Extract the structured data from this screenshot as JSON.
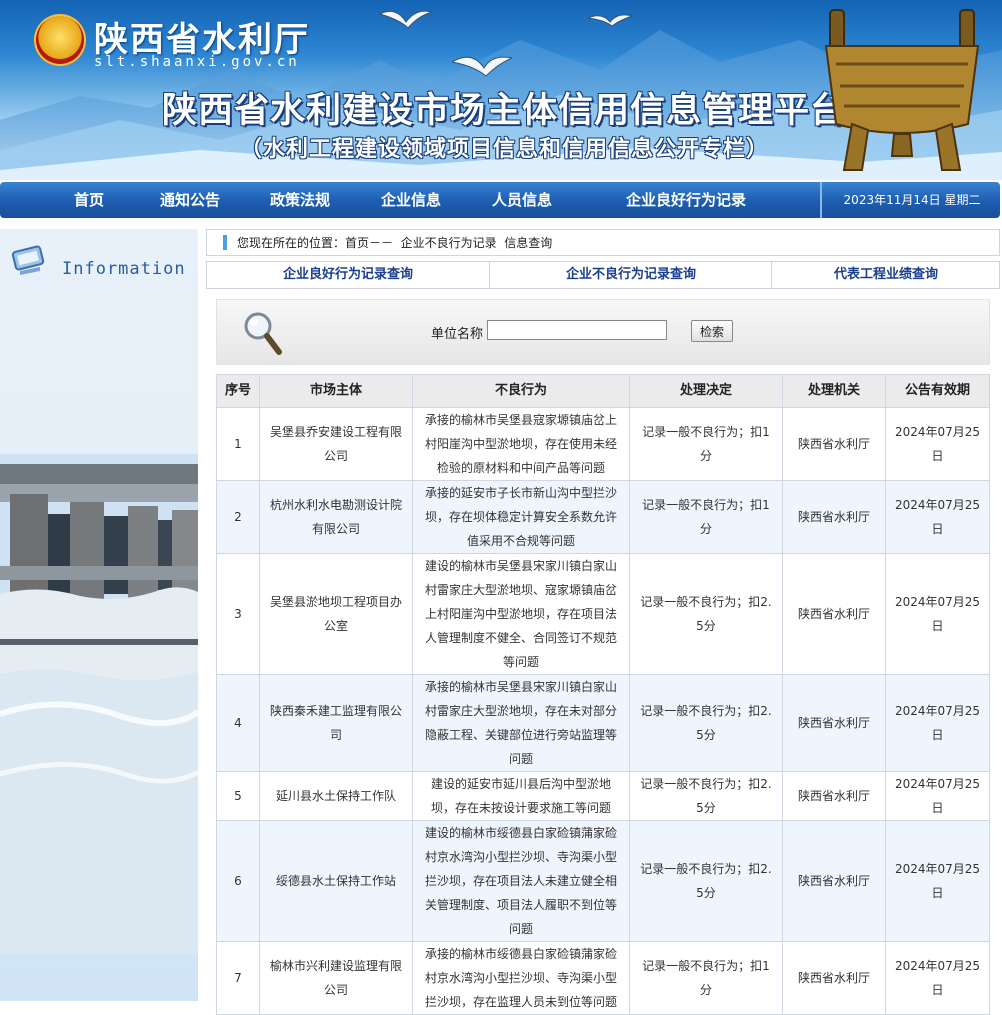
{
  "header": {
    "site_name": "陕西省水利厅",
    "site_domain": "slt.shaanxi.gov.cn",
    "platform_title": "陕西省水利建设市场主体信用信息管理平台",
    "platform_subtitle": "（水利工程建设领域项目信息和信用信息公开专栏）"
  },
  "nav": {
    "items": [
      "首页",
      "通知公告",
      "政策法规",
      "企业信息",
      "人员信息",
      "企业良好行为记录"
    ],
    "date": "2023年11月14日  星期二"
  },
  "sidebar": {
    "label": "Information"
  },
  "breadcrumb": {
    "text": "您现在所在的位置：首页－－  企业不良行为记录  信息查询"
  },
  "tabs": [
    "企业良好行为记录查询",
    "企业不良行为记录查询",
    "代表工程业绩查询"
  ],
  "search": {
    "label": "单位名称",
    "value": "",
    "button": "检索"
  },
  "table": {
    "headers": [
      "序号",
      "市场主体",
      "不良行为",
      "处理决定",
      "处理机关",
      "公告有效期"
    ],
    "rows": [
      [
        "1",
        "吴堡县乔安建设工程有限公司",
        "承接的榆林市吴堡县寇家塬镇庙岔上村阳崖沟中型淤地坝，存在使用未经检验的原材料和中间产品等问题",
        "记录一般不良行为；扣1分",
        "陕西省水利厅",
        "2024年07月25日"
      ],
      [
        "2",
        "杭州水利水电勘测设计院有限公司",
        "承接的延安市子长市新山沟中型拦沙坝，存在坝体稳定计算安全系数允许值采用不合规等问题",
        "记录一般不良行为；扣1分",
        "陕西省水利厅",
        "2024年07月25日"
      ],
      [
        "3",
        "吴堡县淤地坝工程项目办公室",
        "建设的榆林市吴堡县宋家川镇白家山村雷家庄大型淤地坝、寇家塬镇庙岔上村阳崖沟中型淤地坝，存在项目法人管理制度不健全、合同签订不规范等问题",
        "记录一般不良行为；扣2.5分",
        "陕西省水利厅",
        "2024年07月25日"
      ],
      [
        "4",
        "陕西秦禾建工监理有限公司",
        "承接的榆林市吴堡县宋家川镇白家山村雷家庄大型淤地坝，存在未对部分隐蔽工程、关键部位进行旁站监理等问题",
        "记录一般不良行为；扣2.5分",
        "陕西省水利厅",
        "2024年07月25日"
      ],
      [
        "5",
        "延川县水土保持工作队",
        "建设的延安市延川县后沟中型淤地坝，存在未按设计要求施工等问题",
        "记录一般不良行为；扣2.5分",
        "陕西省水利厅",
        "2024年07月25日"
      ],
      [
        "6",
        "绥德县水土保持工作站",
        "建设的榆林市绥德县白家硷镇蒲家硷村京水湾沟小型拦沙坝、寺沟渠小型拦沙坝，存在项目法人未建立健全相关管理制度、项目法人履职不到位等问题",
        "记录一般不良行为；扣2.5分",
        "陕西省水利厅",
        "2024年07月25日"
      ],
      [
        "7",
        "榆林市兴利建设监理有限公司",
        "承接的榆林市绥德县白家硷镇蒲家硷村京水湾沟小型拦沙坝、寺沟渠小型拦沙坝，存在监理人员未到位等问题",
        "记录一般不良行为；扣1分",
        "陕西省水利厅",
        "2024年07月25日"
      ]
    ]
  }
}
